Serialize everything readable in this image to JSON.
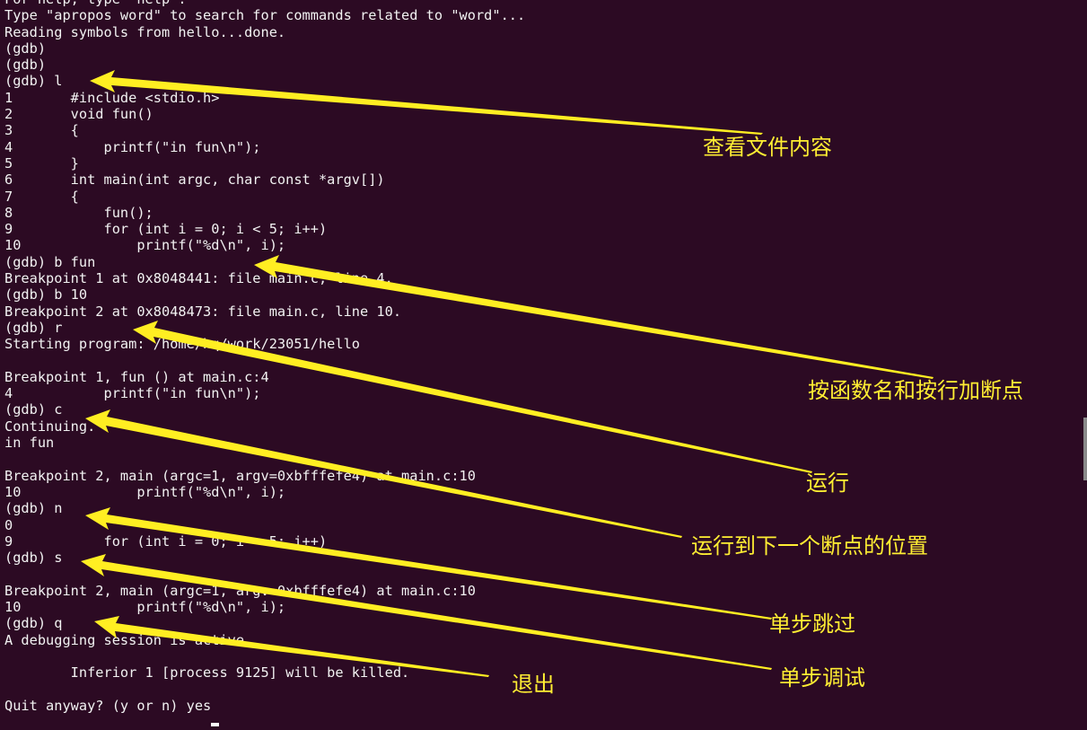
{
  "terminal": {
    "lines": [
      "For help, type \"help\".",
      "Type \"apropos word\" to search for commands related to \"word\"...",
      "Reading symbols from hello...done.",
      "(gdb)",
      "(gdb)",
      "(gdb) l",
      "1       #include <stdio.h>",
      "2       void fun()",
      "3       {",
      "4           printf(\"in fun\\n\");",
      "5       }",
      "6       int main(int argc, char const *argv[])",
      "7       {",
      "8           fun();",
      "9           for (int i = 0; i < 5; i++)",
      "10              printf(\"%d\\n\", i);",
      "(gdb) b fun",
      "Breakpoint 1 at 0x8048441: file main.c, line 4.",
      "(gdb) b 10",
      "Breakpoint 2 at 0x8048473: file main.c, line 10.",
      "(gdb) r",
      "Starting program: /home/hq/work/23051/hello",
      "",
      "Breakpoint 1, fun () at main.c:4",
      "4           printf(\"in fun\\n\");",
      "(gdb) c",
      "Continuing.",
      "in fun",
      "",
      "Breakpoint 2, main (argc=1, argv=0xbfffefe4) at main.c:10",
      "10              printf(\"%d\\n\", i);",
      "(gdb) n",
      "0",
      "9           for (int i = 0; i < 5; i++)",
      "(gdb) s",
      "",
      "Breakpoint 2, main (argc=1, argv=0xbfffefe4) at main.c:10",
      "10              printf(\"%d\\n\", i);",
      "(gdb) q",
      "A debugging session is active.",
      "",
      "        Inferior 1 [process 9125] will be killed.",
      "",
      "Quit anyway? (y or n) yes"
    ]
  },
  "annotations": {
    "view_file": "查看文件内容",
    "breakpoints": "按函数名和按行加断点",
    "run": "运行",
    "continue": "运行到下一个断点的位置",
    "next": "单步跳过",
    "step": "单步调试",
    "quit": "退出"
  },
  "colors": {
    "background": "#2c0a23",
    "terminal_text": "#f2f2f2",
    "annotation": "#ffee33"
  }
}
